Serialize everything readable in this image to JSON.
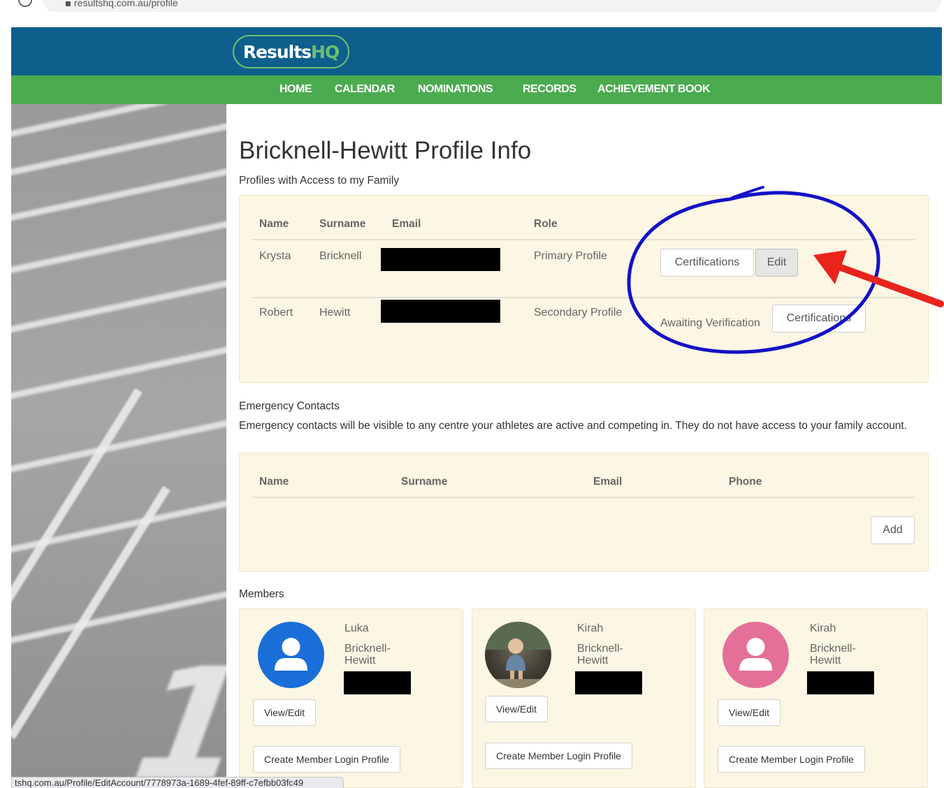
{
  "browser": {
    "url": "resultshq.com.au/profile",
    "status_url": "tshq.com.au/Profile/EditAccount/7778973a-1689-4fef-89ff-c7efbb03fc49"
  },
  "brand": {
    "logo_white": "Results",
    "logo_green": "HQ",
    "blue": "#0e5f8c",
    "green": "#4bab4f"
  },
  "nav": {
    "items": [
      "HOME",
      "CALENDAR",
      "NOMINATIONS",
      "RECORDS",
      "ACHIEVEMENT BOOK"
    ]
  },
  "page": {
    "title": "Bricknell-Hewitt Profile Info"
  },
  "access": {
    "label": "Profiles with Access to my Family",
    "headers": {
      "name": "Name",
      "surname": "Surname",
      "email": "Email",
      "role": "Role"
    },
    "rows": [
      {
        "name": "Krysta",
        "surname": "Bricknell",
        "role": "Primary Profile",
        "certifications_label": "Certifications",
        "edit_label": "Edit"
      },
      {
        "name": "Robert",
        "surname": "Hewitt",
        "role": "Secondary Profile",
        "status": "Awaiting Verification",
        "certifications_label": "Certifications"
      }
    ]
  },
  "emergency": {
    "label": "Emergency Contacts",
    "description": "Emergency contacts will be visible to any centre your athletes are active and competing in. They do not have access to your family account.",
    "headers": {
      "name": "Name",
      "surname": "Surname",
      "email": "Email",
      "phone": "Phone"
    },
    "add_label": "Add"
  },
  "members": {
    "label": "Members",
    "items": [
      {
        "first": "Luka",
        "last": "Bricknell-Hewitt",
        "avatar": "person-icon",
        "avatar_color": "#1a6ed8",
        "view_label": "View/Edit",
        "create_label": "Create Member Login Profile"
      },
      {
        "first": "Kirah",
        "last": "Bricknell-Hewitt",
        "avatar": "child-photo",
        "view_label": "View/Edit",
        "create_label": "Create Member Login Profile"
      },
      {
        "first": "Kirah",
        "last": "Bricknell-Hewitt",
        "avatar": "person-icon",
        "avatar_color": "#e4709a",
        "view_label": "View/Edit",
        "create_label": "Create Member Login Profile"
      }
    ]
  },
  "annotations": {
    "circle_color": "#1410c8",
    "arrow_color": "#e8241c"
  }
}
